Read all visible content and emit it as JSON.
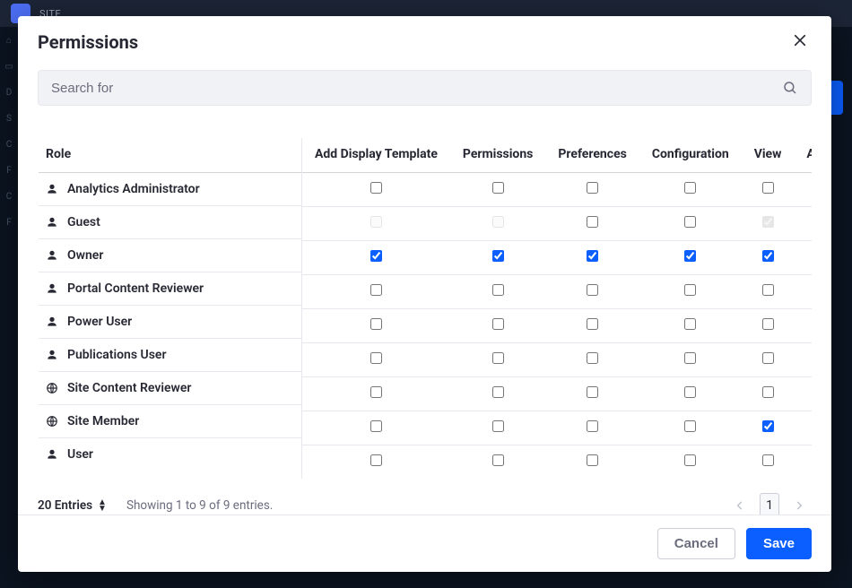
{
  "bg": {
    "site_label": "SITE"
  },
  "modal": {
    "title": "Permissions",
    "search_placeholder": "Search for",
    "close_label": "Close"
  },
  "columns": {
    "role": "Role",
    "perms": [
      "Add Display Template",
      "Permissions",
      "Preferences",
      "Configuration",
      "View",
      "Add to Page"
    ]
  },
  "roles": [
    {
      "name": "Analytics Administrator",
      "icon": "user",
      "checks": [
        false,
        false,
        false,
        false,
        false,
        false
      ],
      "disabled": [],
      "locked": []
    },
    {
      "name": "Guest",
      "icon": "user",
      "checks": [
        false,
        false,
        false,
        false,
        true,
        true
      ],
      "disabled": [
        0,
        1,
        4
      ],
      "locked": [
        5
      ]
    },
    {
      "name": "Owner",
      "icon": "user",
      "checks": [
        true,
        true,
        true,
        true,
        true,
        true
      ],
      "disabled": [],
      "locked": []
    },
    {
      "name": "Portal Content Reviewer",
      "icon": "user",
      "checks": [
        false,
        false,
        false,
        false,
        false,
        false
      ],
      "disabled": [],
      "locked": []
    },
    {
      "name": "Power User",
      "icon": "user",
      "checks": [
        false,
        false,
        false,
        false,
        false,
        true
      ],
      "disabled": [],
      "locked": [
        5
      ]
    },
    {
      "name": "Publications User",
      "icon": "user",
      "checks": [
        false,
        false,
        false,
        false,
        false,
        false
      ],
      "disabled": [],
      "locked": []
    },
    {
      "name": "Site Content Reviewer",
      "icon": "globe",
      "checks": [
        false,
        false,
        false,
        false,
        false,
        false
      ],
      "disabled": [],
      "locked": []
    },
    {
      "name": "Site Member",
      "icon": "globe",
      "checks": [
        false,
        false,
        false,
        false,
        true,
        false
      ],
      "disabled": [],
      "locked": []
    },
    {
      "name": "User",
      "icon": "user",
      "checks": [
        false,
        false,
        false,
        false,
        false,
        true
      ],
      "disabled": [],
      "locked": [
        5
      ]
    }
  ],
  "pager": {
    "entries_label": "20 Entries",
    "info": "Showing 1 to 9 of 9 entries.",
    "current_page": "1"
  },
  "buttons": {
    "cancel": "Cancel",
    "save": "Save"
  }
}
